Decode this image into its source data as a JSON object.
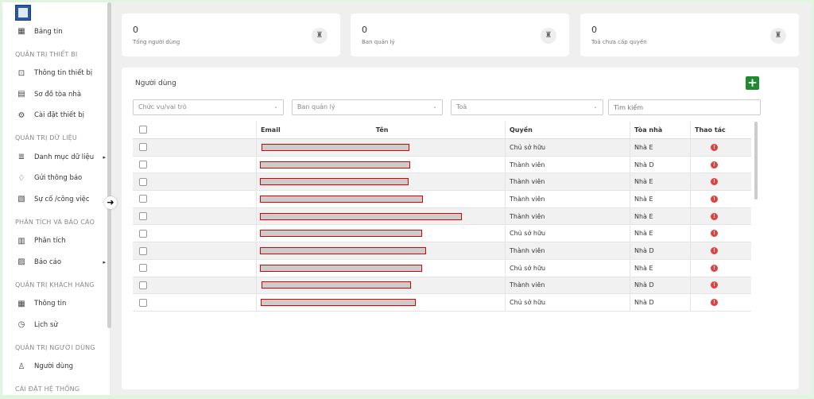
{
  "sidebar": {
    "items": [
      {
        "label": "Bảng tin",
        "icon": "dashboard-icon"
      },
      {
        "section": "QUẢN TRỊ THIẾT BỊ"
      },
      {
        "label": "Thông tin thiết bị",
        "icon": "device-info-icon"
      },
      {
        "label": "Sơ đồ tòa nhà",
        "icon": "building-map-icon"
      },
      {
        "label": "Cài đặt thiết bị",
        "icon": "settings-icon"
      },
      {
        "section": "QUẢN TRỊ DỮ LIỆU"
      },
      {
        "label": "Danh mục dữ liệu",
        "icon": "database-icon",
        "submenu": true
      },
      {
        "label": "Gửi thông báo",
        "icon": "bell-icon"
      },
      {
        "label": "Sự cố /công việc",
        "icon": "task-icon"
      },
      {
        "section": "PHÂN TÍCH VÀ BÁO CÁO"
      },
      {
        "label": "Phân tích",
        "icon": "analytics-icon"
      },
      {
        "label": "Báo cáo",
        "icon": "report-icon",
        "submenu": true
      },
      {
        "section": "QUẢN TRỊ KHÁCH HÀNG"
      },
      {
        "label": "Thông tin",
        "icon": "info-icon"
      },
      {
        "label": "Lịch sử",
        "icon": "history-icon"
      },
      {
        "section": "QUẢN TRỊ NGƯỜI DÙNG"
      },
      {
        "label": "Người dùng",
        "icon": "user-icon"
      },
      {
        "section": "CÀI ĐẶT HỆ THỐNG"
      }
    ]
  },
  "stats": [
    {
      "value": "0",
      "label": "Tổng người dùng"
    },
    {
      "value": "0",
      "label": "Ban quản lý"
    },
    {
      "value": "0",
      "label": "Toà chưa cấp quyền"
    }
  ],
  "main": {
    "title": "Người dùng",
    "add_label": "+",
    "filters": [
      "Chức vụ/vai trò",
      "Ban quản lý",
      "Toà"
    ],
    "search_placeholder": "Tìm kiếm",
    "columns": {
      "email": "Email",
      "name": "Tên",
      "role": "Quyền",
      "building": "Tòa nhà",
      "actions": "Thao tác"
    },
    "rows": [
      {
        "role": "Chủ sở hữu",
        "building": "Nhà E"
      },
      {
        "role": "Thành viên",
        "building": "Nhà D"
      },
      {
        "role": "Thành viên",
        "building": "Nhà E"
      },
      {
        "role": "Thành viên",
        "building": "Nhà E"
      },
      {
        "role": "Thành viên",
        "building": "Nhà E"
      },
      {
        "role": "Chủ sở hữu",
        "building": "Nhà E"
      },
      {
        "role": "Thành viên",
        "building": "Nhà D"
      },
      {
        "role": "Chủ sở hữu",
        "building": "Nhà E"
      },
      {
        "role": "Thành viên",
        "building": "Nhà D"
      },
      {
        "role": "Chủ sở hữu",
        "building": "Nhà D"
      }
    ]
  }
}
